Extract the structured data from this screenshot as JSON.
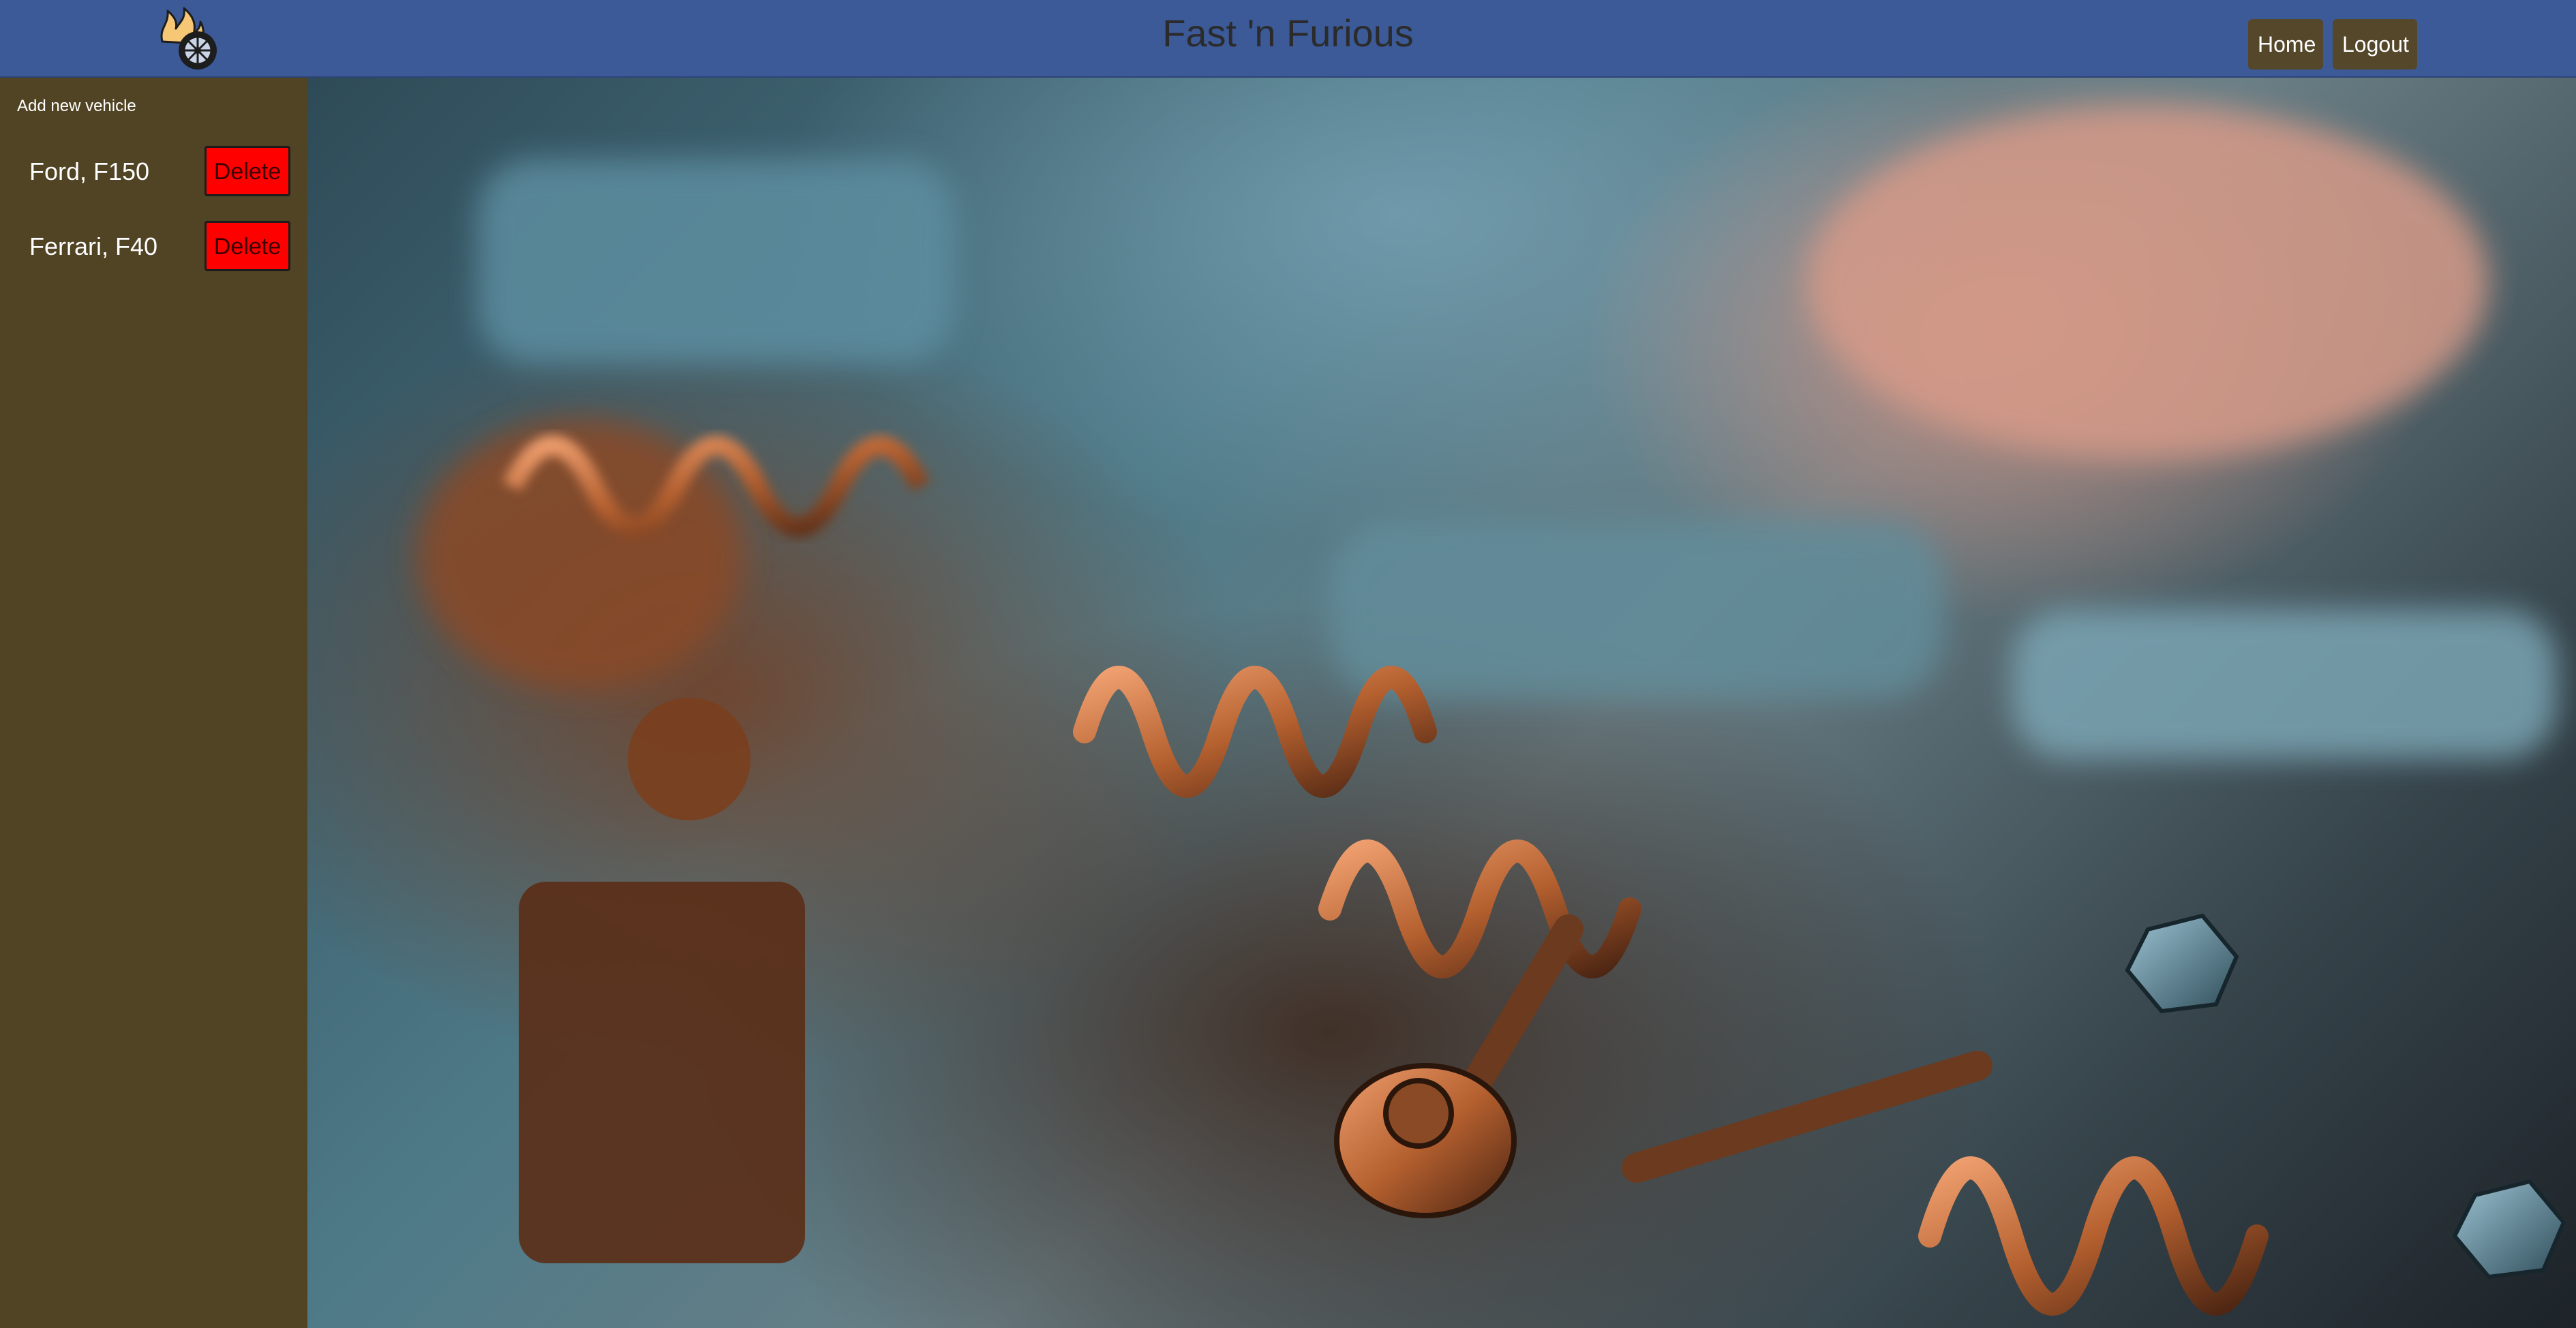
{
  "header": {
    "title": "Fast 'n Furious",
    "nav": {
      "home_label": "Home",
      "logout_label": "Logout"
    }
  },
  "sidebar": {
    "add_label": "Add new vehicle",
    "vehicles": [
      {
        "name": "Ford, F150",
        "delete_label": "Delete"
      },
      {
        "name": "Ferrari, F40",
        "delete_label": "Delete"
      }
    ]
  },
  "icons": {
    "logo": "flaming-wheel-logo-icon"
  },
  "colors": {
    "header_bg": "#3c5a98",
    "sidebar_bg": "#514424",
    "nav_button_bg": "#54472a",
    "delete_button_bg": "#ff0000"
  }
}
